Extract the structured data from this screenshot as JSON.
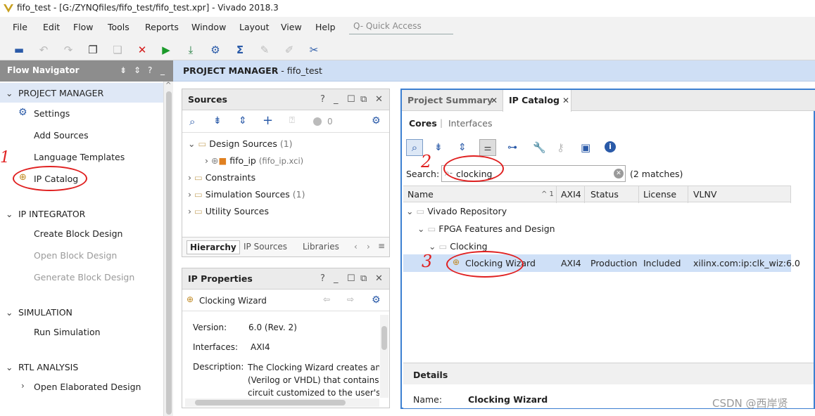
{
  "window": {
    "title": "fifo_test - [G:/ZYNQfiles/fifo_test/fifo_test.xpr] - Vivado 2018.3"
  },
  "menu": [
    "File",
    "Edit",
    "Flow",
    "Tools",
    "Reports",
    "Window",
    "Layout",
    "View",
    "Help"
  ],
  "quick_access": {
    "placeholder": "Q- Quick Access"
  },
  "flow_navigator": {
    "title": "Flow Navigator",
    "sections": {
      "project_manager": "PROJECT MANAGER",
      "ip_integrator": "IP INTEGRATOR",
      "simulation": "SIMULATION",
      "rtl_analysis": "RTL ANALYSIS"
    },
    "items": {
      "settings": "Settings",
      "add_sources": "Add Sources",
      "language_templates": "Language Templates",
      "ip_catalog": "IP Catalog",
      "create_block_design": "Create Block Design",
      "open_block_design": "Open Block Design",
      "generate_block_design": "Generate Block Design",
      "run_simulation": "Run Simulation",
      "open_elaborated_design": "Open Elaborated Design"
    }
  },
  "banner": {
    "prefix": "PROJECT MANAGER",
    "suffix": " - fifo_test"
  },
  "sources": {
    "title": "Sources",
    "count_badge": "0",
    "tree": {
      "design_sources": "Design Sources",
      "design_sources_count": "(1)",
      "fifo_ip": "fifo_ip",
      "fifo_ip_file": "(fifo_ip.xci)",
      "constraints": "Constraints",
      "simulation_sources": "Simulation Sources",
      "simulation_sources_count": "(1)",
      "utility_sources": "Utility Sources"
    },
    "tabs": {
      "hierarchy": "Hierarchy",
      "ip_sources": "IP Sources",
      "libraries": "Libraries"
    }
  },
  "ip_properties": {
    "title": "IP Properties",
    "ip_name": "Clocking Wizard",
    "version_label": "Version:",
    "version_value": "6.0 (Rev. 2)",
    "interfaces_label": "Interfaces:",
    "interfaces_value": "AXI4",
    "description_label": "Description:",
    "description_line1": "The Clocking Wizard creates an HI",
    "description_line2": "(Verilog or VHDL) that contains a c",
    "description_line3": "circuit customized to the user's clo"
  },
  "ip_catalog": {
    "tabs": {
      "project_summary": "Project Summary",
      "ip_catalog": "IP Catalog"
    },
    "subtabs": {
      "cores": "Cores",
      "interfaces": "Interfaces"
    },
    "search": {
      "label": "Search:",
      "value": "clocking",
      "matches": "(2 matches)"
    },
    "columns": {
      "name": "Name",
      "axi4": "AXI4",
      "status": "Status",
      "license": "License",
      "vlnv": "VLNV"
    },
    "sort_indicator": "^ 1",
    "tree": {
      "vivado_repository": "Vivado Repository",
      "fpga_features": "FPGA Features and Design",
      "clocking": "Clocking",
      "clocking_wizard": {
        "name": "Clocking Wizard",
        "axi4": "AXI4",
        "status": "Production",
        "license": "Included",
        "vlnv": "xilinx.com:ip:clk_wiz:6.0"
      }
    },
    "details": {
      "title": "Details",
      "name_label": "Name:",
      "name_value": "Clocking Wizard"
    }
  },
  "annotations": {
    "one": "1",
    "two": "2",
    "three": "3"
  },
  "watermark": "CSDN @西岸贤",
  "colors": {
    "accent": "#3c7fd1",
    "annotation": "#e02020",
    "selection": "#cfe0f7",
    "banner": "#cfdff5"
  }
}
